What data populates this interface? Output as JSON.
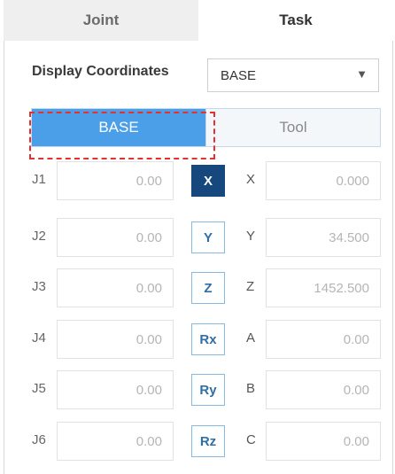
{
  "tabs": [
    {
      "label": "Joint",
      "active": false
    },
    {
      "label": "Task",
      "active": true
    }
  ],
  "display_coordinates": {
    "label": "Display Coordinates",
    "selected": "BASE"
  },
  "frame_toggle": {
    "options": [
      "BASE",
      "Tool"
    ],
    "selected": "BASE"
  },
  "joints": [
    {
      "label": "J1",
      "value": "0.00"
    },
    {
      "label": "J2",
      "value": "0.00"
    },
    {
      "label": "J3",
      "value": "0.00"
    },
    {
      "label": "J4",
      "value": "0.00"
    },
    {
      "label": "J5",
      "value": "0.00"
    },
    {
      "label": "J6",
      "value": "0.00"
    }
  ],
  "axis_buttons": [
    {
      "label": "X",
      "selected": true
    },
    {
      "label": "Y",
      "selected": false
    },
    {
      "label": "Z",
      "selected": false
    },
    {
      "label": "Rx",
      "selected": false
    },
    {
      "label": "Ry",
      "selected": false
    },
    {
      "label": "Rz",
      "selected": false
    }
  ],
  "task_coords": [
    {
      "label": "X",
      "value": "0.000"
    },
    {
      "label": "Y",
      "value": "34.500"
    },
    {
      "label": "Z",
      "value": "1452.500"
    },
    {
      "label": "A",
      "value": "0.00"
    },
    {
      "label": "B",
      "value": "0.00"
    },
    {
      "label": "C",
      "value": "0.00"
    }
  ],
  "colors": {
    "accent": "#4a9fe8",
    "selected_axis": "#16487e",
    "highlight": "#e53030"
  }
}
